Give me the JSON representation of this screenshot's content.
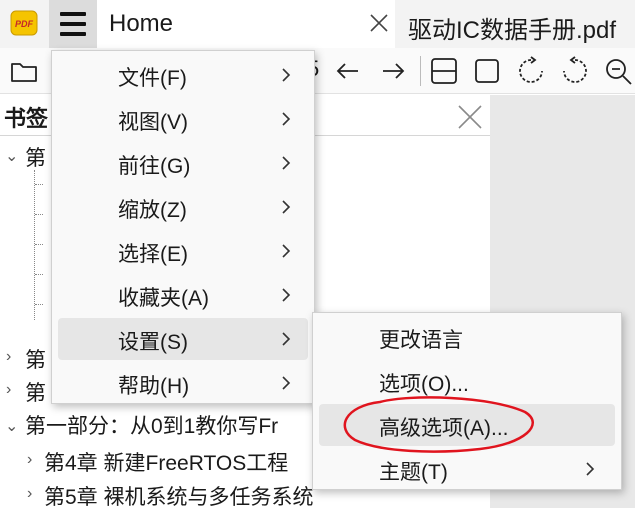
{
  "app": {
    "logo_text": "PDF",
    "tabs": [
      {
        "label": "Home"
      },
      {
        "label": "驱动IC数据手册.pdf"
      }
    ]
  },
  "toolbar": {
    "visible_digit": "5",
    "icons": [
      "open-folder-icon",
      "back-arrow-icon",
      "forward-arrow-icon",
      "fit-width-icon",
      "fit-page-icon",
      "rotate-left-icon",
      "rotate-right-icon",
      "zoom-out-icon"
    ]
  },
  "bookmarks": {
    "title": "书签",
    "rows": [
      {
        "text": "第"
      },
      {
        "text": "第"
      },
      {
        "text": "第"
      },
      {
        "text": "第一部分：从0到1教你写Fr"
      },
      {
        "text": "第4章 新建FreeRTOS工程"
      },
      {
        "text": "第5章 裸机系统与多任务系统"
      }
    ]
  },
  "menu": {
    "items": [
      {
        "label": "文件(F)"
      },
      {
        "label": "视图(V)"
      },
      {
        "label": "前往(G)"
      },
      {
        "label": "缩放(Z)"
      },
      {
        "label": "选择(E)"
      },
      {
        "label": "收藏夹(A)"
      },
      {
        "label": "设置(S)"
      },
      {
        "label": "帮助(H)"
      }
    ],
    "highlighted": "设置(S)"
  },
  "submenu": {
    "items": [
      {
        "label": "更改语言"
      },
      {
        "label": "选项(O)..."
      },
      {
        "label": "高级选项(A)..."
      },
      {
        "label": "主题(T)"
      }
    ],
    "highlighted": "高级选项(A)..."
  },
  "colors": {
    "annotation": "#e0141e",
    "logo_bg": "#f5c400",
    "logo_text": "#c62828",
    "hover": "#e6e6e6"
  }
}
